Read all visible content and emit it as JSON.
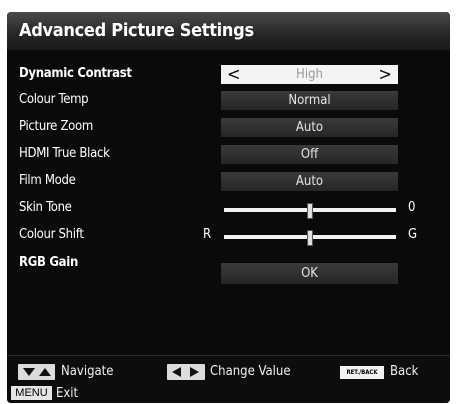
{
  "title": "Advanced Picture Settings",
  "rows": [
    {
      "label": "Dynamic Contrast",
      "value": "High"
    },
    {
      "label": "Colour Temp",
      "value": "Normal"
    },
    {
      "label": "Picture Zoom",
      "value": "Auto"
    },
    {
      "label": "HDMI True Black",
      "value": "Off"
    },
    {
      "label": "Film Mode",
      "value": "Auto"
    },
    {
      "label": "Skin Tone",
      "right_label": "0",
      "level": 0.5
    },
    {
      "label": "Colour Shift",
      "left_label": "R",
      "right_label": "G",
      "level": 0.5
    },
    {
      "label": "RGB Gain",
      "value": "OK"
    }
  ],
  "arrows": {
    "left": "<",
    "right": ">"
  },
  "footer": {
    "navigate": "Navigate",
    "change_value": "Change Value",
    "back_key": "RET./BACK",
    "back": "Back",
    "menu_key": "MENU",
    "exit": "Exit"
  }
}
